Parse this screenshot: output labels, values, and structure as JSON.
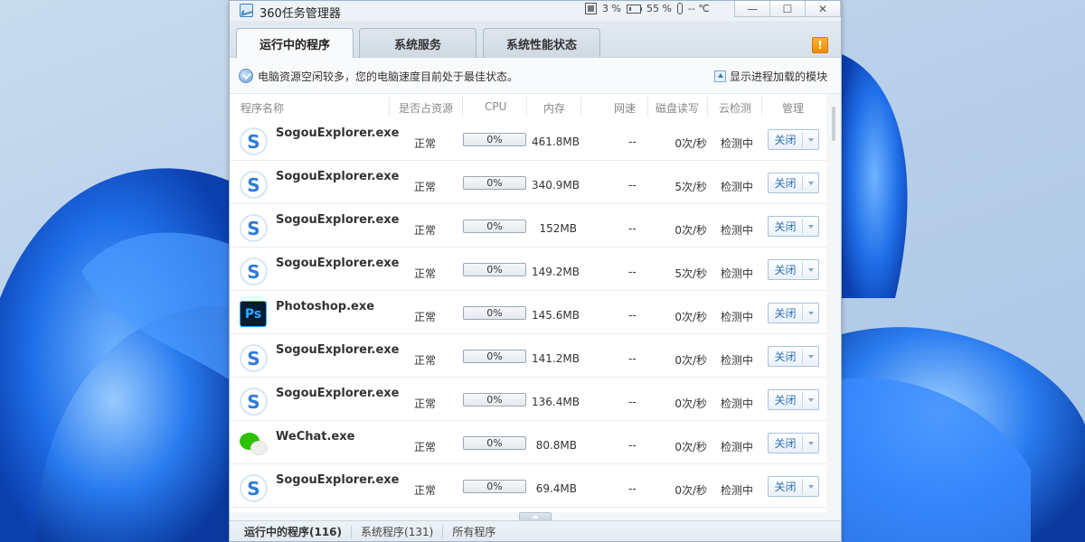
{
  "window": {
    "title": "360任务管理器",
    "cpu_usage": "3 %",
    "mem_usage": "55 %",
    "temperature": "-- ℃",
    "controls": {
      "minimize": "—",
      "maximize": "☐",
      "close": "✕"
    }
  },
  "tabs": [
    {
      "label": "运行中的程序",
      "active": true
    },
    {
      "label": "系统服务",
      "active": false
    },
    {
      "label": "系统性能状态",
      "active": false
    }
  ],
  "warning_badge": "!",
  "status": {
    "message": "电脑资源空闲较多，您的电脑速度目前处于最佳状态。",
    "modules_link": "显示进程加载的模块"
  },
  "columns": [
    "程序名称",
    "是否占资源",
    "CPU",
    "内存",
    "网速",
    "磁盘读写",
    "云检测",
    "管理"
  ],
  "rows": [
    {
      "icon": "sogou-icon",
      "name": "SogouExplorer.exe",
      "resource": "正常",
      "cpu": "0%",
      "memory": "461.8MB",
      "net": "--",
      "disk": "0次/秒",
      "cloud": "检测中",
      "action": "关闭"
    },
    {
      "icon": "sogou-icon",
      "name": "SogouExplorer.exe",
      "resource": "正常",
      "cpu": "0%",
      "memory": "340.9MB",
      "net": "--",
      "disk": "5次/秒",
      "cloud": "检测中",
      "action": "关闭"
    },
    {
      "icon": "sogou-icon",
      "name": "SogouExplorer.exe",
      "resource": "正常",
      "cpu": "0%",
      "memory": "152MB",
      "net": "--",
      "disk": "0次/秒",
      "cloud": "检测中",
      "action": "关闭"
    },
    {
      "icon": "sogou-icon",
      "name": "SogouExplorer.exe",
      "resource": "正常",
      "cpu": "0%",
      "memory": "149.2MB",
      "net": "--",
      "disk": "5次/秒",
      "cloud": "检测中",
      "action": "关闭"
    },
    {
      "icon": "photoshop-icon",
      "name": "Photoshop.exe",
      "resource": "正常",
      "cpu": "0%",
      "memory": "145.6MB",
      "net": "--",
      "disk": "0次/秒",
      "cloud": "检测中",
      "action": "关闭"
    },
    {
      "icon": "sogou-icon",
      "name": "SogouExplorer.exe",
      "resource": "正常",
      "cpu": "0%",
      "memory": "141.2MB",
      "net": "--",
      "disk": "0次/秒",
      "cloud": "检测中",
      "action": "关闭"
    },
    {
      "icon": "sogou-icon",
      "name": "SogouExplorer.exe",
      "resource": "正常",
      "cpu": "0%",
      "memory": "136.4MB",
      "net": "--",
      "disk": "0次/秒",
      "cloud": "检测中",
      "action": "关闭"
    },
    {
      "icon": "wechat-icon",
      "name": "WeChat.exe",
      "resource": "正常",
      "cpu": "0%",
      "memory": "80.8MB",
      "net": "--",
      "disk": "0次/秒",
      "cloud": "检测中",
      "action": "关闭"
    },
    {
      "icon": "sogou-icon",
      "name": "SogouExplorer.exe",
      "resource": "正常",
      "cpu": "0%",
      "memory": "69.4MB",
      "net": "--",
      "disk": "0次/秒",
      "cloud": "检测中",
      "action": "关闭"
    }
  ],
  "bottom_tabs": [
    {
      "label": "运行中的程序(116)",
      "active": true
    },
    {
      "label": "系统程序(131)",
      "active": false
    },
    {
      "label": "所有程序",
      "active": false
    }
  ],
  "colors": {
    "accent": "#2d6fb5",
    "warning": "#f08a00",
    "wallpaper_blue": "#1f6ee8"
  }
}
